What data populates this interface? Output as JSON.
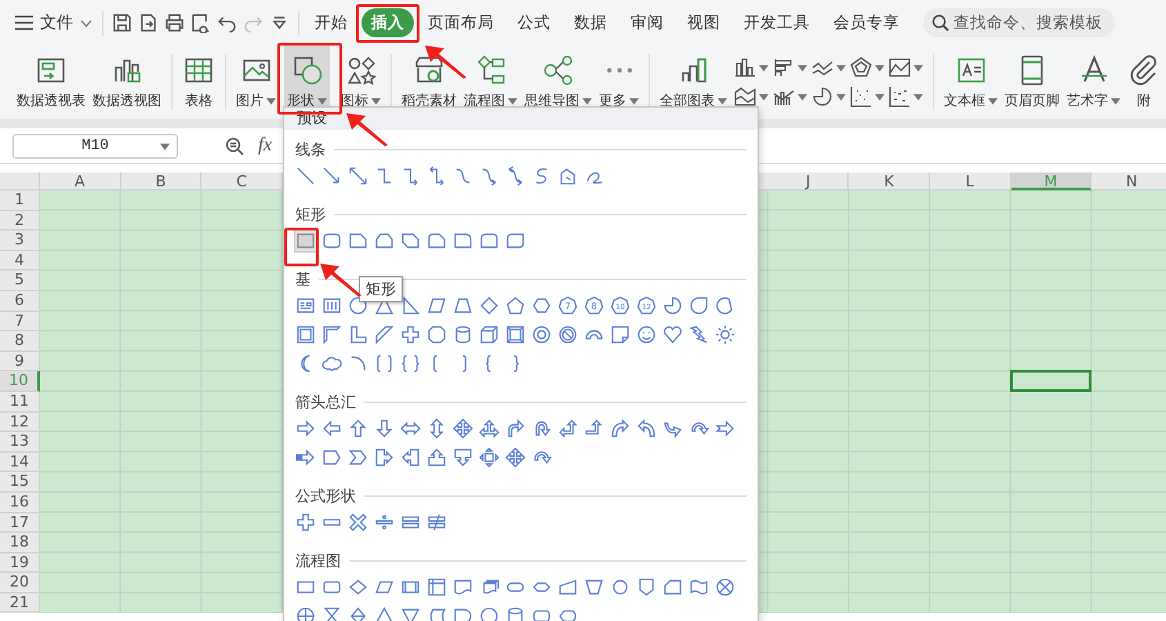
{
  "file_menu": {
    "label": "文件"
  },
  "quick_access": [
    {
      "disabled": false
    },
    {
      "disabled": false
    },
    {
      "disabled": false
    },
    {
      "disabled": false
    },
    {
      "disabled": false
    },
    {
      "disabled": true
    },
    {
      "disabled": false
    }
  ],
  "tabs": [
    {
      "label": "开始",
      "selected": false
    },
    {
      "label": "插入",
      "selected": true
    },
    {
      "label": "页面布局",
      "selected": false
    },
    {
      "label": "公式",
      "selected": false
    },
    {
      "label": "数据",
      "selected": false
    },
    {
      "label": "审阅",
      "selected": false
    },
    {
      "label": "视图",
      "selected": false
    },
    {
      "label": "开发工具",
      "selected": false
    },
    {
      "label": "会员专享",
      "selected": false
    }
  ],
  "search": {
    "placeholder": "查找命令、搜索模板"
  },
  "ribbon": {
    "groups": [
      {
        "items": [
          {
            "kind": "large",
            "label": "数据透视表",
            "dropdown": false,
            "pressed": false
          },
          {
            "kind": "large",
            "label": "数据透视图",
            "dropdown": false,
            "pressed": false
          }
        ]
      },
      {
        "items": [
          {
            "kind": "large",
            "label": "表格",
            "dropdown": false,
            "pressed": false
          }
        ]
      },
      {
        "items": [
          {
            "kind": "large",
            "label": "图片",
            "dropdown": true,
            "pressed": false
          },
          {
            "kind": "large",
            "label": "形状",
            "dropdown": true,
            "pressed": true
          },
          {
            "kind": "large",
            "label": "图标",
            "dropdown": true,
            "pressed": false
          }
        ]
      },
      {
        "items": [
          {
            "kind": "large",
            "label": "稻壳素材",
            "dropdown": false,
            "pressed": false
          },
          {
            "kind": "large",
            "label": "流程图",
            "dropdown": true,
            "pressed": false
          },
          {
            "kind": "large",
            "label": "思维导图",
            "dropdown": true,
            "pressed": false
          },
          {
            "kind": "large",
            "label": "更多",
            "dropdown": true,
            "pressed": false
          }
        ]
      },
      {
        "items": [
          {
            "kind": "large",
            "label": "全部图表",
            "dropdown": true,
            "pressed": false
          },
          {
            "kind": "mini",
            "dropdown": true,
            "pressed": false
          },
          {
            "kind": "mini",
            "dropdown": true,
            "pressed": false
          },
          {
            "kind": "mini",
            "dropdown": true,
            "pressed": false
          },
          {
            "kind": "mini",
            "dropdown": true,
            "pressed": false
          },
          {
            "kind": "mini",
            "dropdown": true,
            "pressed": false
          },
          {
            "kind": "mini",
            "dropdown": true,
            "pressed": false
          },
          {
            "kind": "mini",
            "dropdown": true,
            "pressed": false
          },
          {
            "kind": "mini",
            "dropdown": true,
            "pressed": false
          },
          {
            "kind": "mini",
            "dropdown": true,
            "pressed": false
          },
          {
            "kind": "mini",
            "dropdown": true,
            "pressed": false
          }
        ]
      },
      {
        "items": [
          {
            "kind": "large",
            "label": "文本框",
            "dropdown": true,
            "pressed": false
          },
          {
            "kind": "large",
            "label": "页眉页脚",
            "dropdown": false,
            "pressed": false
          },
          {
            "kind": "large",
            "label": "艺术字",
            "dropdown": true,
            "pressed": false
          },
          {
            "kind": "large",
            "label": "附",
            "dropdown": false,
            "pressed": false
          }
        ]
      }
    ]
  },
  "formula_bar": {
    "name_box": "M10",
    "function_label": "fx"
  },
  "sheet": {
    "columns": [
      {
        "label": "A",
        "selected": false
      },
      {
        "label": "B",
        "selected": false
      },
      {
        "label": "C",
        "selected": false
      },
      {
        "label": "J",
        "selected": false
      },
      {
        "label": "K",
        "selected": false
      },
      {
        "label": "L",
        "selected": false
      },
      {
        "label": "M",
        "selected": true
      },
      {
        "label": "N",
        "selected": false
      }
    ],
    "rows": [
      {
        "label": "1",
        "selected": false
      },
      {
        "label": "2",
        "selected": false
      },
      {
        "label": "3",
        "selected": false
      },
      {
        "label": "4",
        "selected": false
      },
      {
        "label": "5",
        "selected": false
      },
      {
        "label": "6",
        "selected": false
      },
      {
        "label": "7",
        "selected": false
      },
      {
        "label": "8",
        "selected": false
      },
      {
        "label": "9",
        "selected": false
      },
      {
        "label": "10",
        "selected": true
      },
      {
        "label": "11",
        "selected": false
      },
      {
        "label": "12",
        "selected": false
      },
      {
        "label": "13",
        "selected": false
      },
      {
        "label": "14",
        "selected": false
      },
      {
        "label": "15",
        "selected": false
      },
      {
        "label": "16",
        "selected": false
      },
      {
        "label": "17",
        "selected": false
      },
      {
        "label": "18",
        "selected": false
      },
      {
        "label": "19",
        "selected": false
      },
      {
        "label": "20",
        "selected": false
      },
      {
        "label": "21",
        "selected": false
      }
    ]
  },
  "shapes_menu": {
    "header": "预设",
    "tooltip": "矩形",
    "sections": [
      {
        "title": "线条",
        "first_highlighted": false
      },
      {
        "title": "矩形",
        "first_highlighted": true
      },
      {
        "title": "基",
        "first_highlighted": false,
        "icon_numbers": [
          "7",
          "8",
          "10",
          "12"
        ]
      },
      {
        "title": "箭头总汇",
        "first_highlighted": false
      },
      {
        "title": "公式形状",
        "first_highlighted": false
      },
      {
        "title": "流程图",
        "first_highlighted": false
      }
    ]
  }
}
